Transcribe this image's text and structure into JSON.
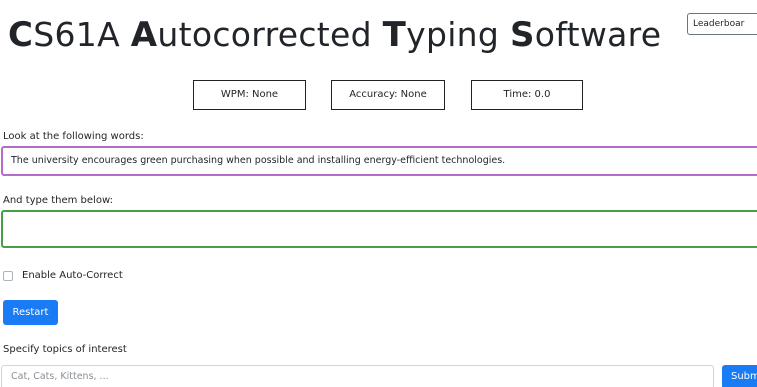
{
  "header": {
    "title_parts": [
      "C",
      "S61A ",
      "A",
      "utocorrected ",
      "T",
      "yping ",
      "S",
      "oftware"
    ],
    "leaderboard_label": "Leaderboar"
  },
  "stats": {
    "wpm": "WPM: None",
    "accuracy": "Accuracy: None",
    "time": "Time: 0.0"
  },
  "prompt": {
    "label": "Look at the following words:",
    "text": "The university encourages green purchasing when possible and installing energy-efficient technologies."
  },
  "typing": {
    "label": "And type them below:",
    "value": ""
  },
  "autocorrect": {
    "label": "Enable Auto-Correct",
    "checked": false
  },
  "restart": {
    "label": "Restart"
  },
  "topics": {
    "label": "Specify topics of interest",
    "placeholder": "Cat, Cats, Kittens, ...",
    "submit_label": "Subm"
  },
  "colors": {
    "primary": "#1a7cf5",
    "prompt_border": "#b66bcb",
    "typing_border": "#43a047"
  }
}
